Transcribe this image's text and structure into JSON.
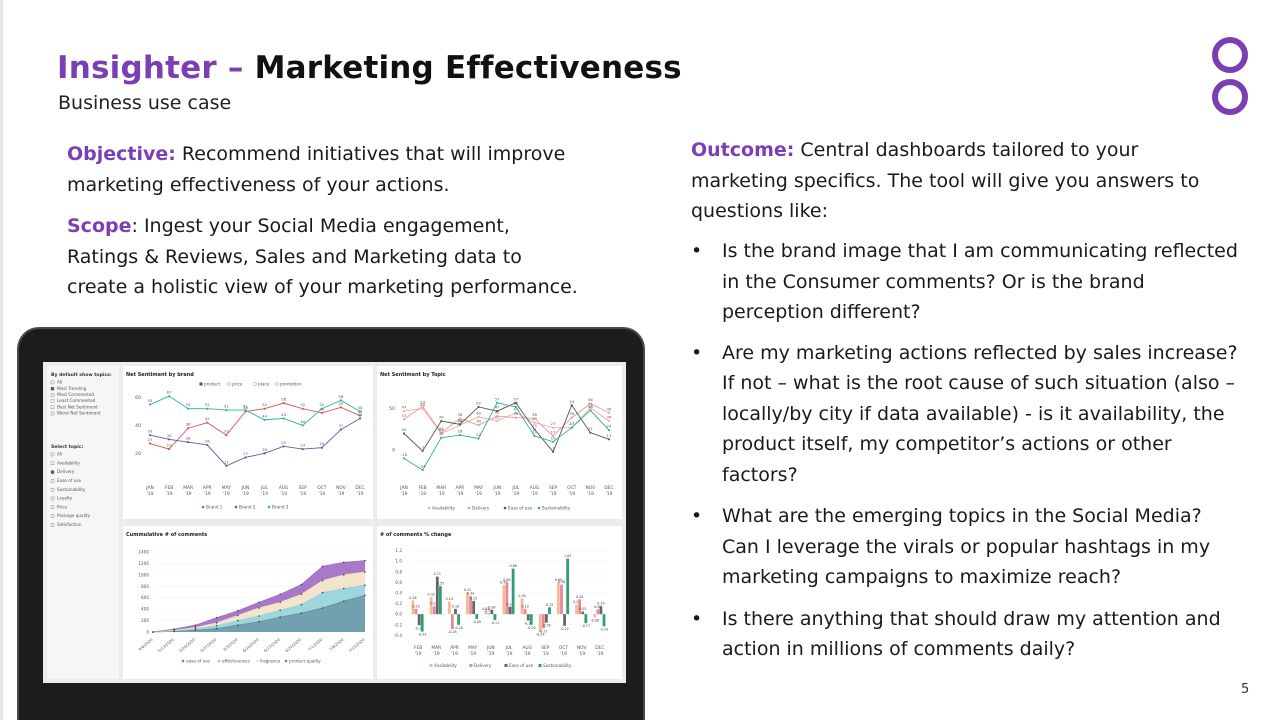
{
  "header": {
    "brand": "Insighter",
    "dash": "–",
    "title": "Marketing Effectiveness",
    "subtitle": "Business use case"
  },
  "objective": {
    "label": "Objective:",
    "text": " Recommend initiatives that will improve marketing effectiveness of your actions."
  },
  "scope": {
    "label": "Scope",
    "text": ": Ingest your Social Media engagement, Ratings & Reviews, Sales and Marketing data to create a holistic view of your marketing performance."
  },
  "outcome": {
    "label": "Outcome:",
    "text": " Central dashboards tailored to your marketing specifics. The tool will give you answers to questions like:"
  },
  "bullets": [
    "Is the brand image that I am communicating reflected in the Consumer comments? Or is the brand perception different?",
    "Are my marketing actions reflected by sales increase? If not – what is the root cause of such situation (also – locally/by city if data available) - is it availability, the product itself, my competitor’s actions or other factors?",
    "What are the emerging topics in the Social Media? Can I leverage the virals or popular hashtags in my marketing campaigns to maximize reach?",
    "Is there anything that should draw my attention and action in millions of comments daily?"
  ],
  "bullet_symbol": "•",
  "page_number": "5",
  "colors": {
    "accent": "#7b3fb4",
    "text": "#1a1a1a",
    "laptop": "#1c1c1c"
  },
  "dashboard": {
    "sidebar": {
      "filter1_title": "By default show topics:",
      "filter1_items": [
        "All",
        "Most Trending",
        "Most Commented",
        "Least Commented",
        "Best Net Sentiment",
        "Worst Net Sentiment"
      ],
      "filter2_title": "Select topic:",
      "filter2_items": [
        "All",
        "Availability",
        "Delivery",
        "Ease of use",
        "Sustainability",
        "Loyalty",
        "Price",
        "Package quality",
        "Satisfaction"
      ]
    },
    "months": [
      "JAN",
      "FEB",
      "MAR",
      "APR",
      "MAY",
      "JUN",
      "JUL",
      "AUG",
      "SEP",
      "OCT",
      "NOV",
      "DEC"
    ],
    "year_label": "'19",
    "chart_data": [
      {
        "type": "line",
        "title": "Net Sentiment by brand",
        "toggles": [
          "product",
          "price",
          "place",
          "promotion"
        ],
        "categories": [
          "JAN",
          "FEB",
          "MAR",
          "APR",
          "MAY",
          "JUN",
          "JUL",
          "AUG",
          "SEP",
          "OCT",
          "NOV",
          "DEC"
        ],
        "yticks": [
          20,
          40,
          60
        ],
        "ylim": [
          8,
          64
        ],
        "series": [
          {
            "name": "Brand 1",
            "color": "#e05353",
            "values": [
              27,
              23,
              38,
              42,
              33,
              50,
              52,
              56,
              52,
              49,
              53,
              47
            ]
          },
          {
            "name": "Brand 2",
            "color": "#6a56a8",
            "values": [
              33,
              30,
              28,
              26,
              11,
              17,
              20,
              25,
              23,
              24,
              37,
              45
            ]
          },
          {
            "name": "Brand 3",
            "color": "#2bb39c",
            "values": [
              55,
              61,
              52,
              52,
              51,
              51,
              44,
              45,
              40,
              52,
              58,
              50
            ]
          }
        ]
      },
      {
        "type": "line",
        "title": "Net Sentiment by Topic",
        "categories": [
          "JAN",
          "FEB",
          "MAR",
          "APR",
          "MAY",
          "JUN",
          "JUL",
          "AUG",
          "SEP",
          "OCT",
          "NOV",
          "DEC"
        ],
        "yticks": [
          0,
          50
        ],
        "ylim": [
          -30,
          70
        ],
        "series": [
          {
            "name": "Availability",
            "color": "#f0b090",
            "values": [
              47,
              50,
              20,
              30,
              40,
              35,
              45,
              33,
              27,
              27,
              51,
              35
            ]
          },
          {
            "name": "Delivery",
            "color": "#e89aa0",
            "values": [
              37,
              53,
              21,
              38,
              30,
              41,
              39,
              38,
              17,
              39,
              56,
              45
            ]
          },
          {
            "name": "Ease of use",
            "color": "#555555",
            "values": [
              20,
              -1,
              35,
              31,
              52,
              47,
              57,
              25,
              -2,
              54,
              21,
              13
            ]
          },
          {
            "name": "Sustainability",
            "color": "#2bb39c",
            "values": [
              -10,
              -24,
              15,
              18,
              14,
              57,
              52,
              17,
              10,
              27,
              48,
              24
            ]
          }
        ]
      },
      {
        "type": "area",
        "title": "Cummulative # of comments",
        "categories": [
          "4/6/2020",
          "5/13/2020",
          "5/20/2020",
          "5/27/2020",
          "6/3/2020",
          "6/10/2020",
          "6/17/2020",
          "6/24/2020",
          "7/1/2020",
          "7/8/2020",
          "7/15/2020"
        ],
        "yticks": [
          0,
          200,
          400,
          600,
          800,
          1000,
          1200,
          1400
        ],
        "ylim": [
          0,
          1400
        ],
        "series": [
          {
            "name": "ease of use",
            "color": "#5a8fa0",
            "values": [
              0,
              10,
              30,
              60,
              120,
              180,
              260,
              330,
              420,
              540,
              640
            ]
          },
          {
            "name": "effectiveness",
            "color": "#8ecfd5",
            "values": [
              0,
              20,
              55,
              110,
              200,
              280,
              380,
              480,
              690,
              760,
              820
            ]
          },
          {
            "name": "fragrance",
            "color": "#f2dfc2",
            "values": [
              0,
              30,
              80,
              160,
              290,
              420,
              520,
              660,
              900,
              1000,
              1050
            ]
          },
          {
            "name": "product quality",
            "color": "#9a62c0",
            "values": [
              0,
              50,
              120,
              250,
              370,
              520,
              660,
              830,
              1150,
              1220,
              1250
            ]
          }
        ]
      },
      {
        "type": "bar",
        "title": "# of comments % change",
        "categories": [
          "FEB",
          "MAR",
          "APR",
          "MAY",
          "JUN",
          "JUL",
          "AUG",
          "SEP",
          "OCT",
          "NOV",
          "DEC"
        ],
        "yticks": [
          -0.4,
          -0.2,
          0.0,
          0.2,
          0.4,
          0.6,
          0.8,
          1.0,
          1.2
        ],
        "ylim": [
          -0.45,
          1.25
        ],
        "series": [
          {
            "name": "Availability",
            "color": "#f4b89a",
            "values": [
              0.26,
              0.32,
              0.24,
              0.41,
              0.05,
              0.55,
              0.3,
              -0.33,
              0.6,
              0.18,
              -0.06
            ]
          },
          {
            "name": "Delivery",
            "color": "#e68a9a",
            "values": [
              0.1,
              0.15,
              -0.28,
              0.34,
              0.02,
              0.6,
              0.1,
              -0.27,
              0.56,
              0.28,
              0.09
            ]
          },
          {
            "name": "Ease of use",
            "color": "#666666",
            "values": [
              -0.21,
              0.71,
              0.1,
              0.25,
              0.08,
              0.14,
              -0.12,
              -0.16,
              -0.22,
              0.05,
              0.15
            ]
          },
          {
            "name": "Sustainability",
            "color": "#2e9e75",
            "values": [
              -0.33,
              0.53,
              -0.2,
              -0.09,
              -0.11,
              0.86,
              -0.2,
              0.13,
              1.05,
              -0.17,
              -0.23
            ]
          }
        ]
      }
    ]
  }
}
